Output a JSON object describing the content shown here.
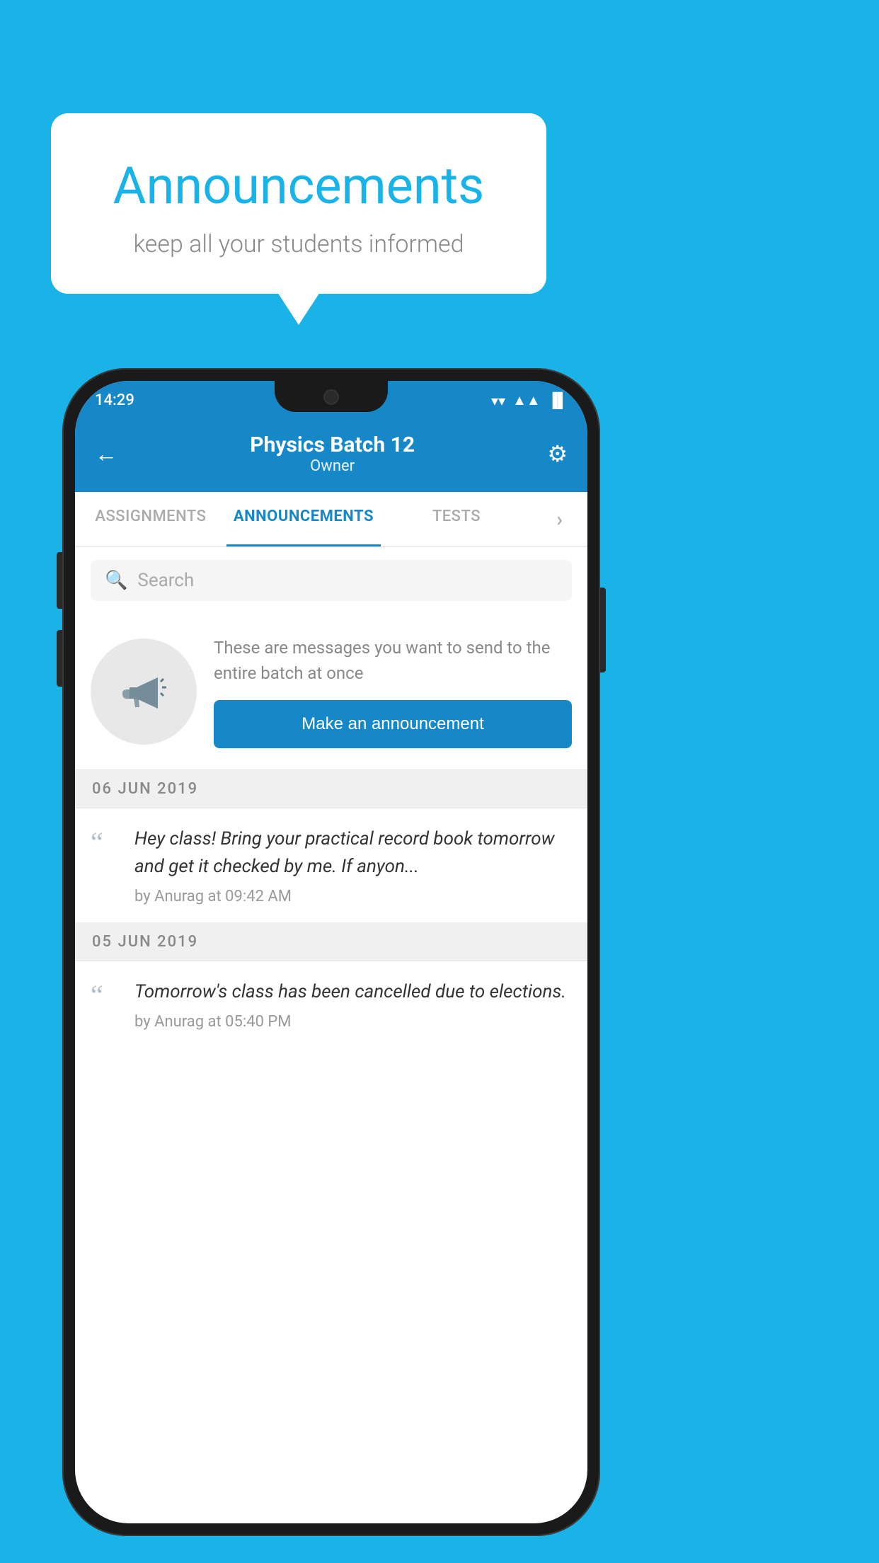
{
  "bubble": {
    "title": "Announcements",
    "subtitle": "keep all your students informed"
  },
  "statusBar": {
    "time": "14:29",
    "wifi": "▼",
    "signal": "▲",
    "battery": "▌"
  },
  "header": {
    "title": "Physics Batch 12",
    "subtitle": "Owner",
    "backLabel": "←",
    "gearLabel": "⚙"
  },
  "tabs": [
    {
      "label": "ASSIGNMENTS",
      "active": false
    },
    {
      "label": "ANNOUNCEMENTS",
      "active": true
    },
    {
      "label": "TESTS",
      "active": false
    },
    {
      "label": "›",
      "active": false
    }
  ],
  "search": {
    "placeholder": "Search"
  },
  "promo": {
    "description": "These are messages you want to send to the entire batch at once",
    "buttonLabel": "Make an announcement"
  },
  "dates": [
    {
      "label": "06  JUN  2019",
      "announcements": [
        {
          "text": "Hey class! Bring your practical record book tomorrow and get it checked by me. If anyon...",
          "meta": "by Anurag at 09:42 AM"
        }
      ]
    },
    {
      "label": "05  JUN  2019",
      "announcements": [
        {
          "text": "Tomorrow's class has been cancelled due to elections.",
          "meta": "by Anurag at 05:40 PM"
        }
      ]
    }
  ]
}
